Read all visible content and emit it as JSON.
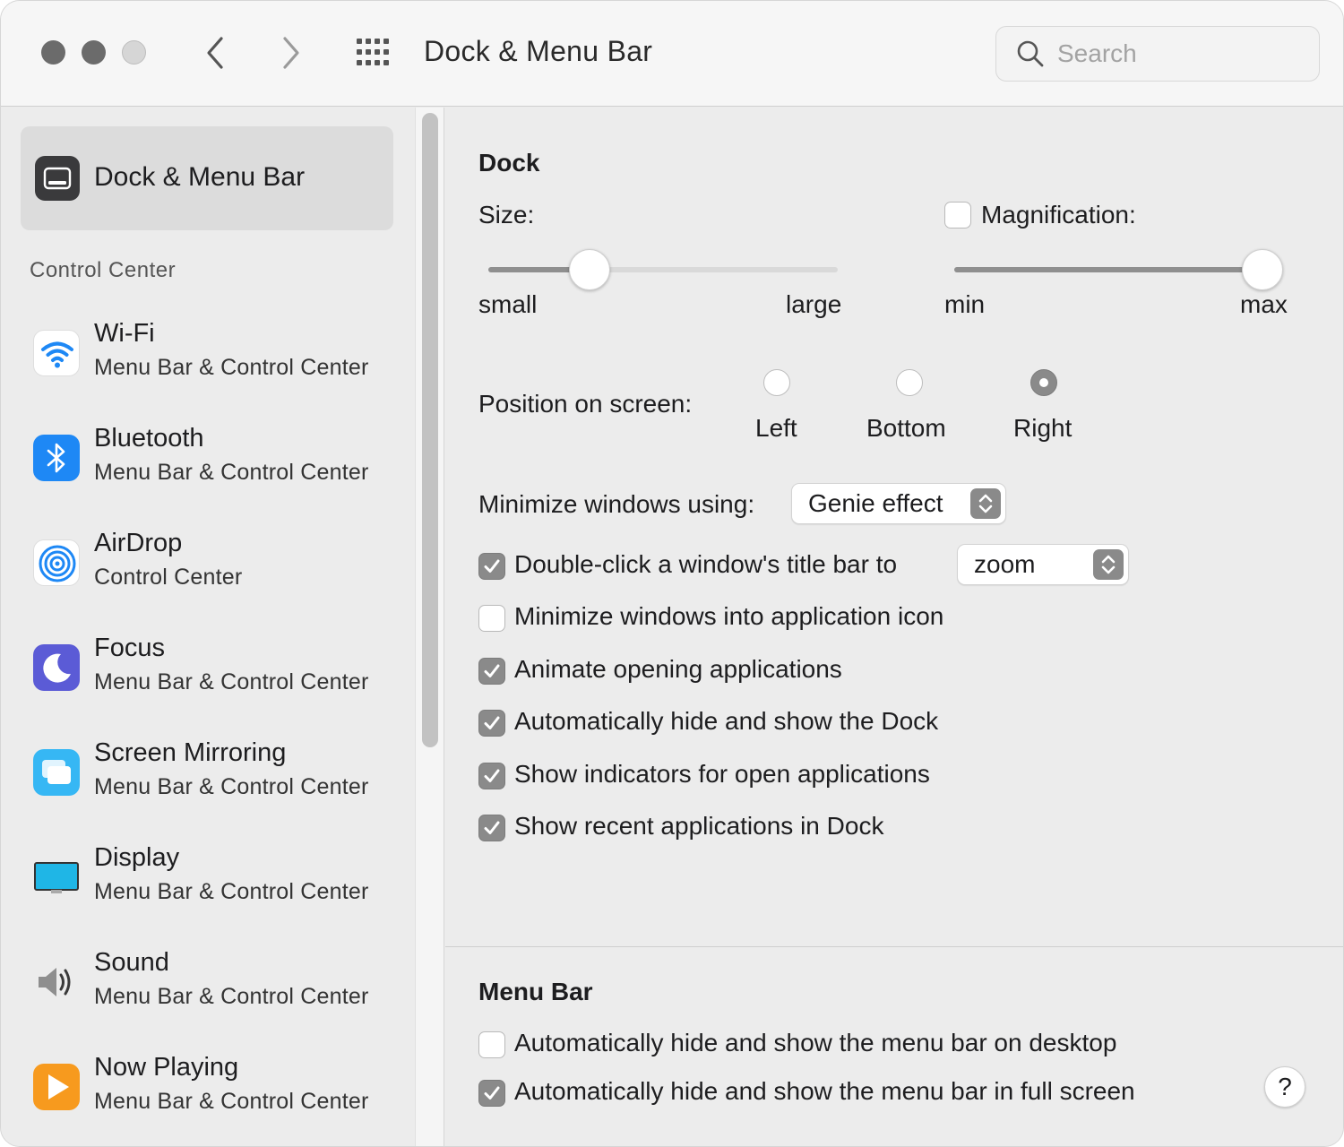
{
  "window": {
    "title": "Dock & Menu Bar"
  },
  "search": {
    "placeholder": "Search"
  },
  "sidebar": {
    "selected": {
      "label": "Dock & Menu Bar"
    },
    "section_header": "Control Center",
    "items": [
      {
        "name": "Wi-Fi",
        "sub": "Menu Bar & Control Center",
        "icon": "wifi-icon",
        "color": "#ffffff"
      },
      {
        "name": "Bluetooth",
        "sub": "Menu Bar & Control Center",
        "icon": "bluetooth-icon",
        "color": "#1e88f5"
      },
      {
        "name": "AirDrop",
        "sub": "Control Center",
        "icon": "airdrop-icon",
        "color": "#ffffff"
      },
      {
        "name": "Focus",
        "sub": "Menu Bar & Control Center",
        "icon": "moon-icon",
        "color": "#5b5bd6"
      },
      {
        "name": "Screen Mirroring",
        "sub": "Menu Bar & Control Center",
        "icon": "screen-mirroring-icon",
        "color": "#36b7f4"
      },
      {
        "name": "Display",
        "sub": "Menu Bar & Control Center",
        "icon": "display-icon",
        "color": "#1fb6e6"
      },
      {
        "name": "Sound",
        "sub": "Menu Bar & Control Center",
        "icon": "speaker-icon",
        "color": "#8e8e8e"
      },
      {
        "name": "Now Playing",
        "sub": "Menu Bar & Control Center",
        "icon": "play-icon",
        "color": "#f79a1e"
      }
    ]
  },
  "dock": {
    "heading": "Dock",
    "size": {
      "label": "Size:",
      "min_label": "small",
      "max_label": "large",
      "value": 0.29
    },
    "magnification": {
      "label": "Magnification:",
      "checked": false,
      "min_label": "min",
      "max_label": "max",
      "value": 1.0
    },
    "position": {
      "label": "Position on screen:",
      "options": [
        "Left",
        "Bottom",
        "Right"
      ],
      "selected": "Right"
    },
    "minimize_using": {
      "label": "Minimize windows using:",
      "value": "Genie effect"
    },
    "double_click": {
      "label": "Double-click a window's title bar to",
      "checked": true,
      "value": "zoom"
    },
    "options": [
      {
        "label": "Minimize windows into application icon",
        "checked": false
      },
      {
        "label": "Animate opening applications",
        "checked": true
      },
      {
        "label": "Automatically hide and show the Dock",
        "checked": true
      },
      {
        "label": "Show indicators for open applications",
        "checked": true
      },
      {
        "label": "Show recent applications in Dock",
        "checked": true
      }
    ]
  },
  "menu_bar": {
    "heading": "Menu Bar",
    "options": [
      {
        "label": "Automatically hide and show the menu bar on desktop",
        "checked": false
      },
      {
        "label": "Automatically hide and show the menu bar in full screen",
        "checked": true
      }
    ]
  },
  "help": {
    "label": "?"
  },
  "colors": {
    "accent_gray": "#8a8a8a",
    "window_bg": "#ececec"
  }
}
